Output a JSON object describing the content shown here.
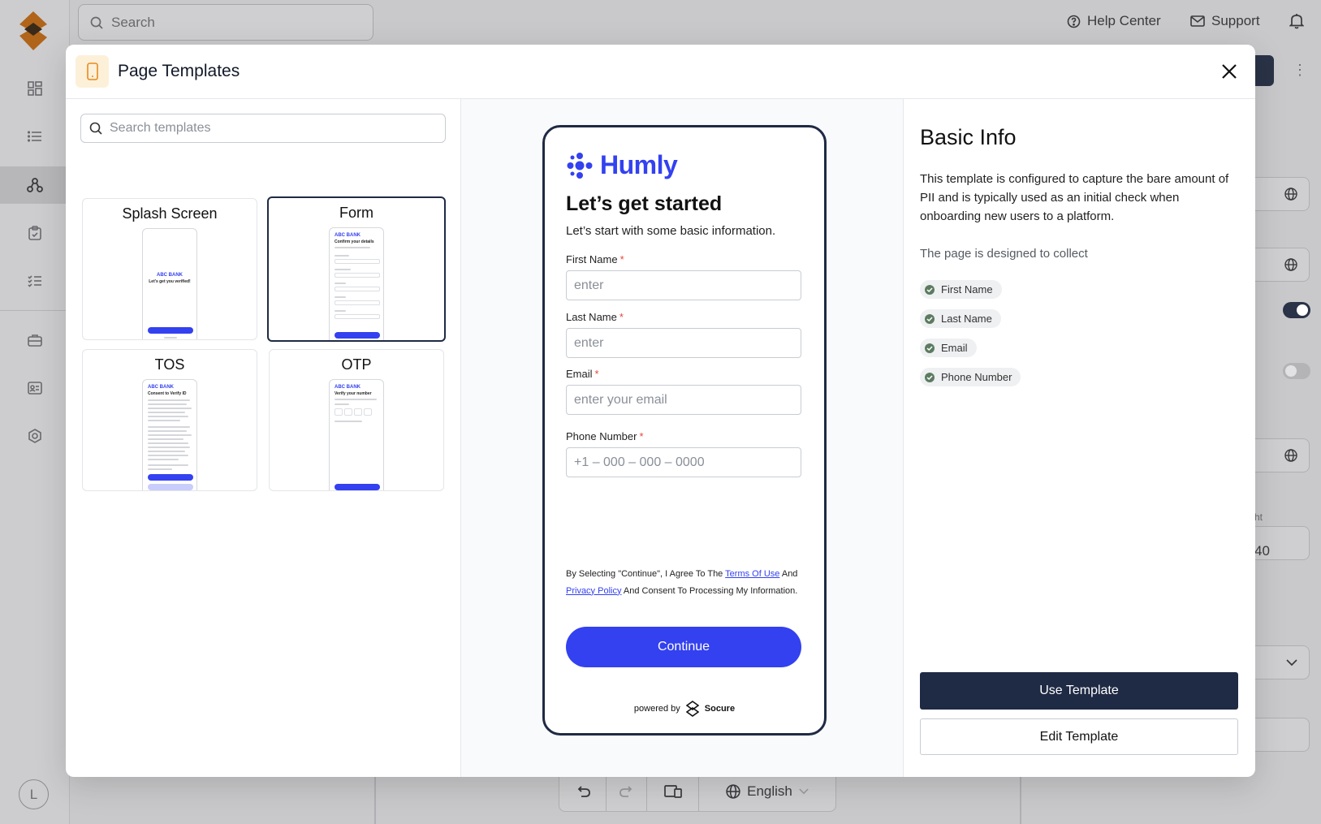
{
  "topbar": {
    "search_placeholder": "Search",
    "help_center": "Help Center",
    "support": "Support"
  },
  "sidebar": {
    "avatar_initial": "L",
    "items": [
      "dashboard-icon",
      "list-icon",
      "flow-icon",
      "clipboard-icon",
      "checklist-icon",
      "briefcase-icon",
      "id-card-icon",
      "settings-hex-icon"
    ]
  },
  "background": {
    "height_label": "ht",
    "height_value": "40",
    "language": "English"
  },
  "modal": {
    "title": "Page Templates",
    "search_placeholder": "Search templates",
    "templates": [
      {
        "name": "Splash Screen",
        "thumb_brand": "ABC BANK",
        "thumb_title": "Let's get you verified!"
      },
      {
        "name": "Form",
        "thumb_brand": "ABC BANK",
        "thumb_title": "Confirm your details"
      },
      {
        "name": "TOS",
        "thumb_brand": "ABC BANK",
        "thumb_title": "Consent to Verify ID"
      },
      {
        "name": "OTP",
        "thumb_brand": "ABC BANK",
        "thumb_title": "Verify your number"
      }
    ],
    "selected_template": "Form"
  },
  "preview": {
    "brand": "Humly",
    "title": "Let’s get started",
    "subtitle": "Let’s start with some basic information.",
    "required_mark": "*",
    "fields": [
      {
        "label": "First Name",
        "placeholder": "enter"
      },
      {
        "label": "Last Name",
        "placeholder": "enter"
      },
      {
        "label": "Email",
        "placeholder": "enter your email"
      },
      {
        "label": "Phone Number",
        "placeholder": "+1 – 000 – 000 – 0000"
      }
    ],
    "legal": {
      "part1": "By Selecting \"Continue\", I Agree To The ",
      "terms_link": "Terms Of Use",
      "part2": " And ",
      "privacy_link": "Privacy Policy",
      "part3": " And Consent To Processing My Information."
    },
    "continue_label": "Continue",
    "powered_by": "powered by",
    "powered_brand": "Socure"
  },
  "info": {
    "title": "Basic Info",
    "description": "This template is configured to capture the bare amount of PII and is typically used as an initial check when onboarding new users to a platform.",
    "collect_label": "The page is designed to collect",
    "collected_fields": [
      "First Name",
      "Last Name",
      "Email",
      "Phone Number"
    ],
    "use_template": "Use Template",
    "edit_template": "Edit Template"
  },
  "colors": {
    "brand_blue": "#3341F0",
    "navy": "#1F2A44",
    "required_red": "#E5483C",
    "template_icon_bg": "#FDF0D9",
    "template_icon": "#E8891C"
  }
}
